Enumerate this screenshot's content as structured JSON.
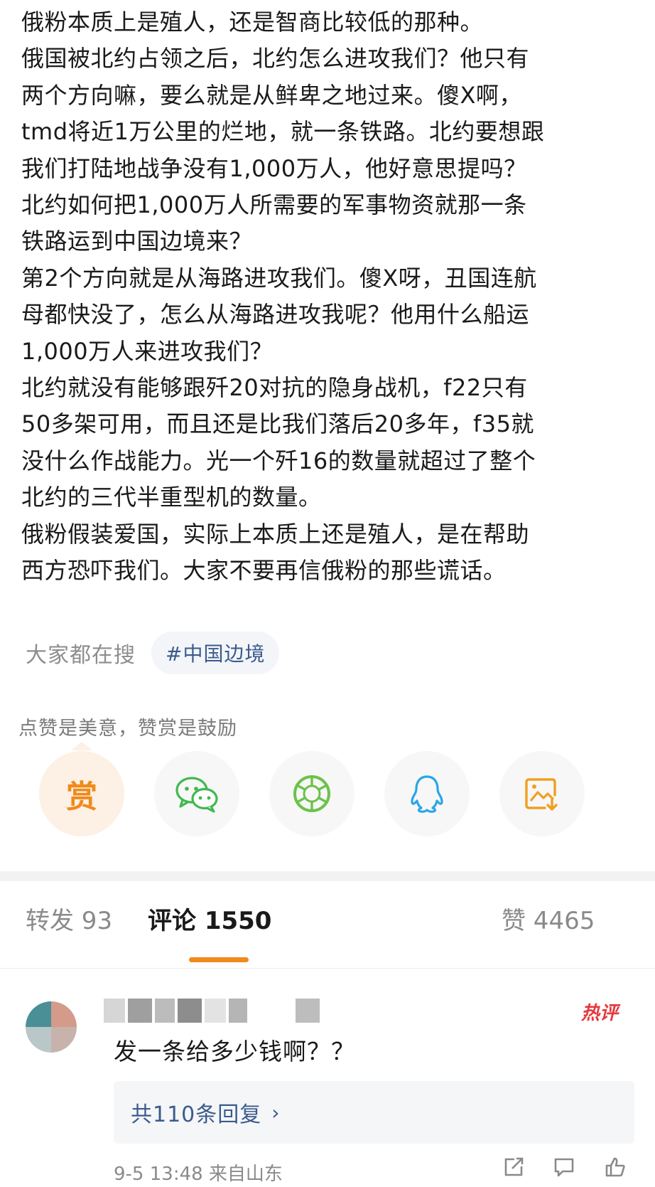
{
  "post": {
    "lines": [
      "俄粉本质上是殖人，还是智商比较低的那种。",
      "俄国被北约占领之后，北约怎么进攻我们？他只有",
      "两个方向嘛，要么就是从鲜卑之地过来。傻X啊，",
      "tmd将近1万公里的烂地，就一条铁路。北约要想跟",
      "我们打陆地战争没有1,000万人，他好意思提吗？",
      "北约如何把1,000万人所需要的军事物资就那一条",
      "铁路运到中国边境来？",
      "第2个方向就是从海路进攻我们。傻X呀，丑国连航",
      "母都快没了，怎么从海路进攻我呢？他用什么船运",
      "1,000万人来进攻我们？",
      "北约就没有能够跟歼20对抗的隐身战机，f22只有",
      "50多架可用，而且还是比我们落后20多年，f35就",
      "没什么作战能力。光一个歼16的数量就超过了整个",
      "北约的三代半重型机的数量。",
      "俄粉假装爱国，实际上本质上还是殖人，是在帮助",
      "西方恐吓我们。大家不要再信俄粉的那些谎话。"
    ]
  },
  "search": {
    "label": "大家都在搜",
    "hashtag": "#中国边境"
  },
  "reward_tip": "点赞是美意，赞赏是鼓励",
  "share": {
    "reward_glyph": "赏",
    "icons": [
      "reward-icon",
      "wechat-icon",
      "moments-icon",
      "qq-icon",
      "save-image-icon"
    ],
    "colors": {
      "reward": "#f08a1c",
      "wechat": "#3fb950",
      "moments": "#6cc24a",
      "qq": "#2aa6e8",
      "save": "#f0a020"
    }
  },
  "tabs": {
    "repost": "转发 93",
    "comments": "评论 1550",
    "likes": "赞 4465"
  },
  "comment": {
    "badge": "热评",
    "text": "发一条给多少钱啊？？",
    "replies": "共110条回复",
    "replies_chevron": "›",
    "meta": "9-5 13:48 来自山东"
  },
  "colors": {
    "accent": "#f08a1c",
    "link": "#3b5b8c",
    "hot": "#e4393c"
  }
}
